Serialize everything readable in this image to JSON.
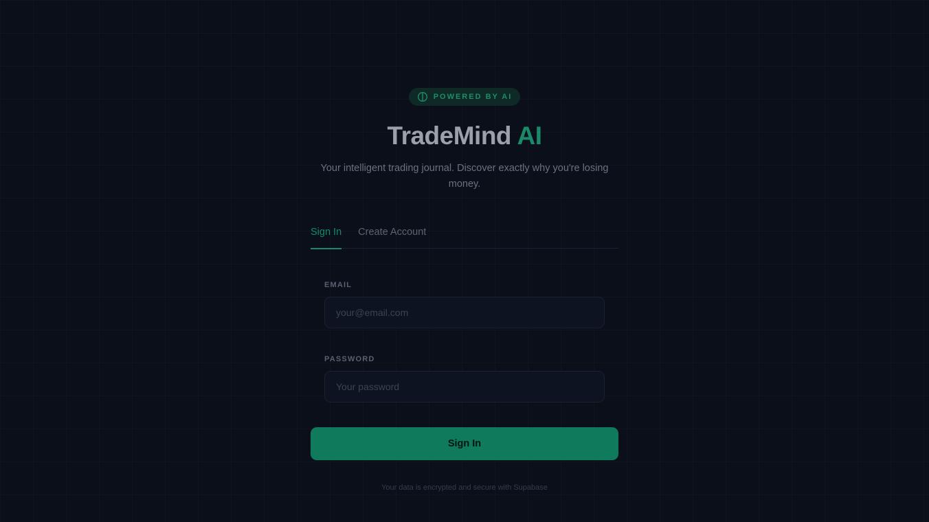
{
  "badge": {
    "icon": "brain-icon",
    "text": "POWERED BY AI"
  },
  "brand": {
    "name": "TradeMind",
    "accent": "AI",
    "accent_color": "#1a8a68"
  },
  "subtitle": "Your intelligent trading journal. Discover exactly why you're losing money.",
  "tabs": [
    {
      "label": "Sign In",
      "active": true
    },
    {
      "label": "Create Account",
      "active": false
    }
  ],
  "form": {
    "email": {
      "label": "EMAIL",
      "placeholder": "your@email.com",
      "value": ""
    },
    "password": {
      "label": "PASSWORD",
      "placeholder": "Your password",
      "value": ""
    },
    "submit_label": "Sign In"
  },
  "footnote": "Your data is encrypted and secure with Supabase",
  "colors": {
    "background": "#0a0f1a",
    "primary": "#0f7a5c",
    "accent": "#178a66"
  }
}
